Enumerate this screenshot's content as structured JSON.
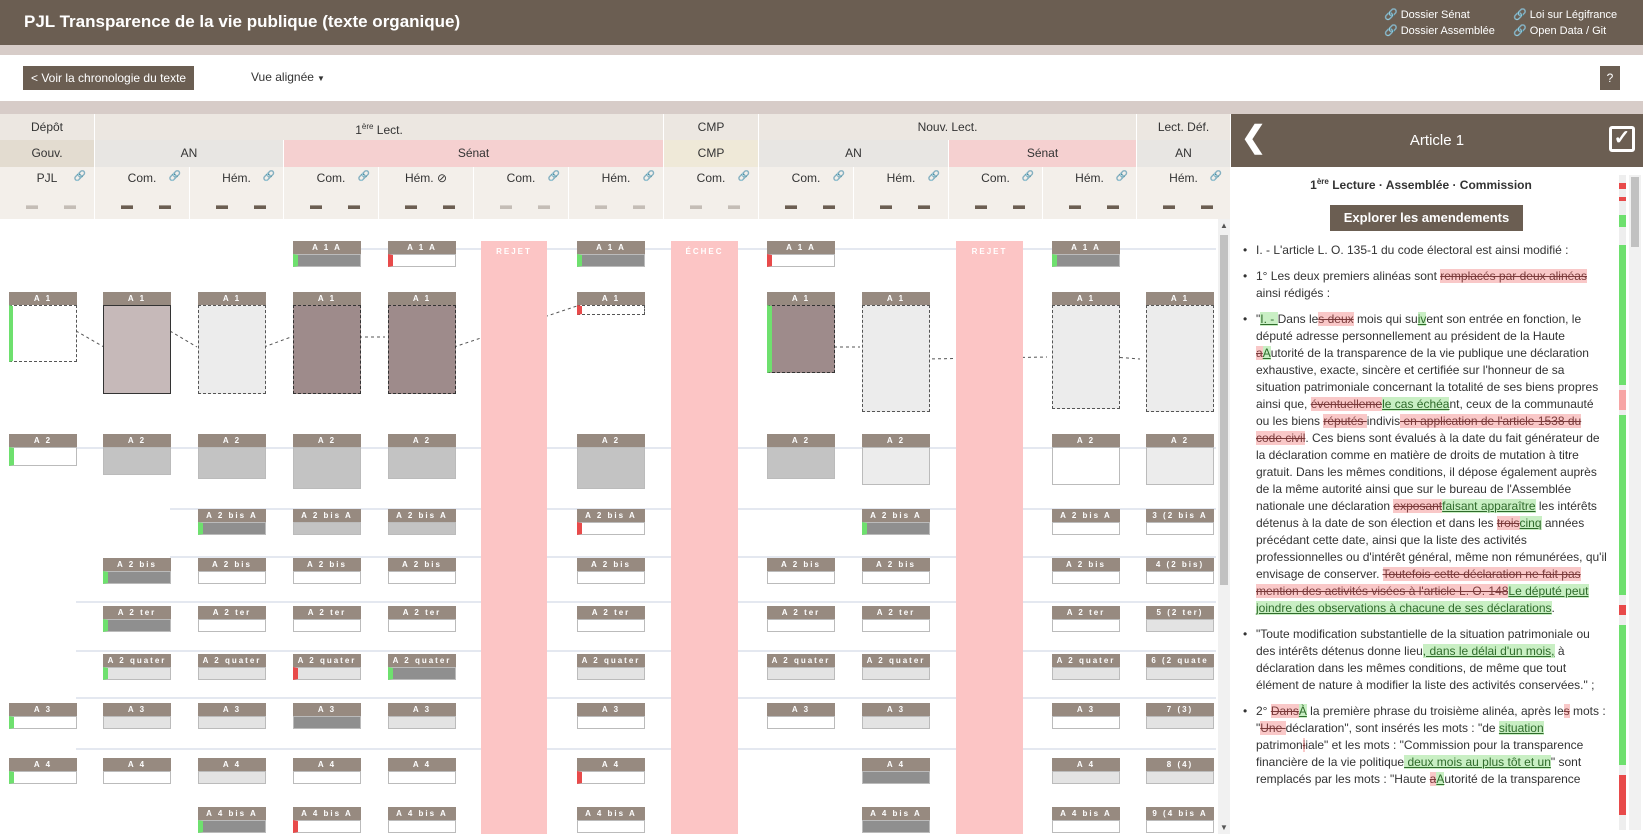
{
  "header": {
    "title": "PJL Transparence de la vie publique (texte organique)",
    "links": [
      "Dossier Sénat",
      "Dossier Assemblée",
      "Loi sur Légifrance",
      "Open Data",
      "/ Git"
    ]
  },
  "toolbar": {
    "back_label": "< Voir la chronologie du texte",
    "view_label": "Vue alignée",
    "help_label": "?"
  },
  "grid": {
    "row1": [
      "Dépôt",
      "1ère Lect.",
      "CMP",
      "Nouv. Lect.",
      "Lect. Déf."
    ],
    "row2": [
      "Gouv.",
      "AN",
      "Sénat",
      "CMP",
      "AN",
      "Sénat",
      "AN"
    ],
    "row3": [
      "PJL",
      "Com.",
      "Hém.",
      "Com.",
      "Hém.",
      "Com.",
      "Hém.",
      "Com.",
      "Com.",
      "Hém.",
      "Com.",
      "Hém.",
      "Hém."
    ],
    "bands": [
      "REJET",
      "ÉCHEC",
      "REJET"
    ]
  },
  "articles": {
    "row_a1a": "A 1 A",
    "row_a1": "A 1",
    "row_a2": "A 2",
    "row_a2bisa": "A 2 bis A",
    "row_a2bis": "A 2 bis",
    "row_a2ter": "A 2 ter",
    "row_a2quater": "A 2 quater",
    "row_a3": "A 3",
    "row_a4": "A 4",
    "row_a4bisa": "A 4 bis A",
    "final_labels": [
      "3 (2 bis A",
      "4 (2 bis)",
      "5 (2 ter)",
      "6 (2 quate",
      "7 (3)",
      "8 (4)",
      "9 (4 bis A"
    ]
  },
  "panel": {
    "title": "Article 1",
    "subtitle_pre": "1",
    "subtitle_sup": "ère",
    "subtitle_post": " Lecture · Assemblée · Commission",
    "explore_label": "Explorer les amendements"
  },
  "colors": {
    "brand": "#6b5e52",
    "senat": "#f5d0d0",
    "rejet": "#fcc5c5",
    "insert": "#c9efc4",
    "delete": "#f9c8c8"
  }
}
